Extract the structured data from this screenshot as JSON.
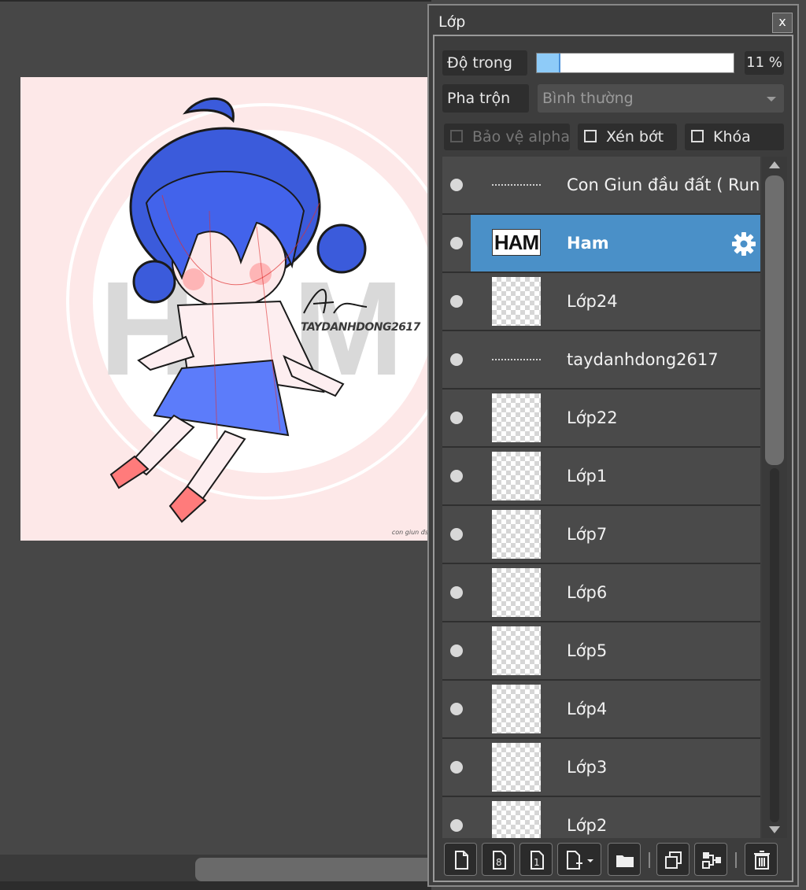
{
  "canvas": {
    "signature": "TAYDANHDONG2617",
    "watermark": "HAM",
    "credit": "con giun đs"
  },
  "panel": {
    "title": "Lớp",
    "close_label": "x",
    "opacity": {
      "label": "Độ trong",
      "value_text": "11 %",
      "value": 11
    },
    "blend": {
      "label": "Pha trộn",
      "selected": "Bình thường"
    },
    "checks": {
      "protect_alpha": {
        "label": "Bảo vệ alpha",
        "checked": false,
        "enabled": false
      },
      "clip": {
        "label": "Xén bớt",
        "checked": false,
        "enabled": true
      },
      "lock": {
        "label": "Khóa",
        "checked": false,
        "enabled": true
      }
    },
    "layers": [
      {
        "name": "Con Giun đầu đất ( Run",
        "thumb": "text",
        "selected": false
      },
      {
        "name": "Ham",
        "thumb": "ham",
        "thumb_text": "HAM",
        "selected": true
      },
      {
        "name": "Lớp24",
        "thumb": "empty",
        "selected": false
      },
      {
        "name": "taydanhdong2617",
        "thumb": "text",
        "selected": false
      },
      {
        "name": "Lớp22",
        "thumb": "empty",
        "selected": false
      },
      {
        "name": "Lớp1",
        "thumb": "empty",
        "selected": false
      },
      {
        "name": "Lớp7",
        "thumb": "empty",
        "selected": false
      },
      {
        "name": "Lớp6",
        "thumb": "empty",
        "selected": false
      },
      {
        "name": "Lớp5",
        "thumb": "empty",
        "selected": false
      },
      {
        "name": "Lớp4",
        "thumb": "empty",
        "selected": false
      },
      {
        "name": "Lớp3",
        "thumb": "empty",
        "selected": false
      },
      {
        "name": "Lớp2",
        "thumb": "empty",
        "selected": false
      }
    ],
    "toolbar_icons": [
      "new-layer-icon",
      "new-8bit-layer-icon",
      "new-1bit-layer-icon",
      "add-layer-menu-icon",
      "folder-icon",
      "duplicate-layer-icon",
      "merge-layer-icon",
      "trash-icon"
    ]
  },
  "colors": {
    "selected_row": "#4a90c8",
    "opacity_fill": "#8ecbf8",
    "hair": "#3b5bdb"
  }
}
